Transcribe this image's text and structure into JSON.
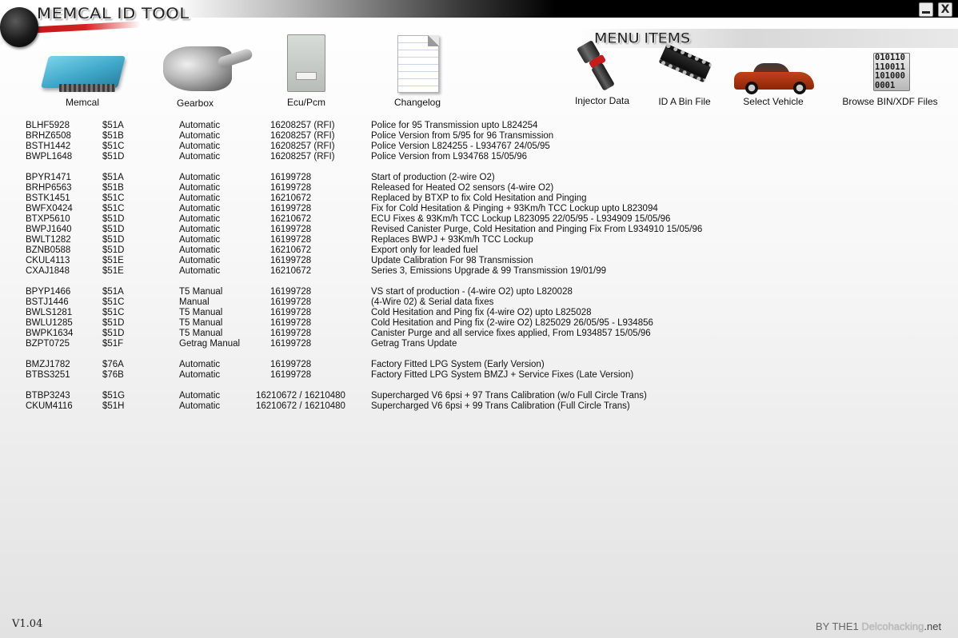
{
  "window": {
    "title": "MEMCAL ID TOOL",
    "minimize_label": "",
    "close_label": "X"
  },
  "menu": {
    "header": "MENU ITEMS"
  },
  "tools_left": [
    {
      "label": "Memcal",
      "icon": "memcal-icon"
    },
    {
      "label": "Gearbox",
      "icon": "gearbox-icon"
    },
    {
      "label": "Ecu/Pcm",
      "icon": "ecu-icon"
    },
    {
      "label": "Changelog",
      "icon": "changelog-icon"
    }
  ],
  "tools_right": [
    {
      "label": "Injector Data",
      "icon": "injector-icon"
    },
    {
      "label": "ID A Bin File",
      "icon": "chip-icon"
    },
    {
      "label": "Select Vehicle",
      "icon": "car-icon"
    },
    {
      "label": "Browse BIN/XDF Files",
      "icon": "binary-file-icon",
      "glyph": "010110\n110011\n101000\n0001"
    }
  ],
  "table": {
    "rows": [
      {
        "id": "BLHF5928",
        "code": "$51A",
        "trans": "Automatic",
        "pn": "16208257 (RFI)",
        "desc": "Police for 95 Transmission upto L824254"
      },
      {
        "id": "BRHZ6508",
        "code": "$51B",
        "trans": "Automatic",
        "pn": "16208257 (RFI)",
        "desc": "Police Version from 5/95 for 96 Transmission"
      },
      {
        "id": "BSTH1442",
        "code": "$51C",
        "trans": "Automatic",
        "pn": "16208257 (RFI)",
        "desc": "Police Version L824255 - L934767 24/05/95"
      },
      {
        "id": "BWPL1648",
        "code": "$51D",
        "trans": "Automatic",
        "pn": "16208257 (RFI)",
        "desc": "Police Version from L934768 15/05/96"
      },
      {
        "id": "BPYR1471",
        "code": "$51A",
        "trans": "Automatic",
        "pn": "16199728",
        "desc": "Start of production (2-wire O2)"
      },
      {
        "id": "BRHP6563",
        "code": "$51B",
        "trans": "Automatic",
        "pn": "16199728",
        "desc": "Released for Heated O2 sensors (4-wire O2)"
      },
      {
        "id": "BSTK1451",
        "code": "$51C",
        "trans": "Automatic",
        "pn": "16210672",
        "desc": "Replaced by BTXP to fix Cold Hesitation and Pinging"
      },
      {
        "id": "BWFX0424",
        "code": "$51C",
        "trans": "Automatic",
        "pn": "16199728",
        "desc": "Fix for Cold Hesitation & Pinging + 93Km/h TCC Lockup upto L823094"
      },
      {
        "id": "BTXP5610",
        "code": "$51D",
        "trans": "Automatic",
        "pn": "16210672",
        "desc": "ECU Fixes & 93Km/h TCC Lockup L823095 22/05/95 - L934909 15/05/96"
      },
      {
        "id": "BWPJ1640",
        "code": "$51D",
        "trans": "Automatic",
        "pn": "16199728",
        "desc": "Revised Canister Purge, Cold Hesitation and Pinging Fix From L934910 15/05/96"
      },
      {
        "id": "BWLT1282",
        "code": "$51D",
        "trans": "Automatic",
        "pn": "16199728",
        "desc": "Replaces BWPJ + 93Km/h TCC Lockup"
      },
      {
        "id": "BZNB0588",
        "code": "$51D",
        "trans": "Automatic",
        "pn": "16210672",
        "desc": "Export only for leaded fuel"
      },
      {
        "id": "CKUL4113",
        "code": "$51E",
        "trans": "Automatic",
        "pn": "16199728",
        "desc": "Update Calibration For 98 Transmission"
      },
      {
        "id": "CXAJ1848",
        "code": "$51E",
        "trans": "Automatic",
        "pn": "16210672",
        "desc": "Series 3, Emissions Upgrade & 99 Transmission 19/01/99"
      },
      {
        "id": "BPYP1466",
        "code": "$51A",
        "trans": "T5 Manual",
        "pn": "16199728",
        "desc": "VS start of production - (4-wire O2) upto L820028"
      },
      {
        "id": "BSTJ1446",
        "code": "$51C",
        "trans": "Manual",
        "pn": "16199728",
        "desc": "(4-Wire 02) & Serial data fixes"
      },
      {
        "id": "BWLS1281",
        "code": "$51C",
        "trans": "T5 Manual",
        "pn": "16199728",
        "desc": "Cold Hesitation and Ping fix (4-wire O2) upto L825028"
      },
      {
        "id": "BWLU1285",
        "code": "$51D",
        "trans": "T5 Manual",
        "pn": "16199728",
        "desc": "Cold Hesitation and Ping fix (2-wire O2) L825029 26/05/95 - L934856"
      },
      {
        "id": "BWPK1634",
        "code": "$51D",
        "trans": "T5 Manual",
        "pn": "16199728",
        "desc": "Canister Purge and all service fixes applied, From L934857 15/05/96"
      },
      {
        "id": "BZPT0725",
        "code": "$51F",
        "trans": "Getrag Manual",
        "pn": "16199728",
        "desc": "Getrag Trans Update"
      },
      {
        "id": "BMZJ1782",
        "code": "$76A",
        "trans": "Automatic",
        "pn": "16199728",
        "desc": "Factory Fitted LPG System (Early Version)"
      },
      {
        "id": "BTBS3251",
        "code": "$76B",
        "trans": "Automatic",
        "pn": "16199728",
        "desc": "Factory Fitted LPG System BMZJ + Service Fixes (Late Version)"
      },
      {
        "id": "BTBP3243",
        "code": "$51G",
        "trans": "Automatic",
        "pn": "16210672 / 16210480",
        "desc": "Supercharged V6 6psi + 97 Trans Calibration (w/o Full Circle Trans)"
      },
      {
        "id": "CKUM4116",
        "code": "$51H",
        "trans": "Automatic",
        "pn": "16210672 / 16210480",
        "desc": "Supercharged V6 6psi + 99 Trans Calibration (Full Circle Trans)"
      }
    ]
  },
  "footer": {
    "version": "V1.04",
    "credit_by": "BY THE1",
    "credit_site": "Delcohacking",
    "credit_tld": ".net"
  },
  "colors": {
    "accent": "#d42020",
    "titlebar_dark": "#000000"
  }
}
